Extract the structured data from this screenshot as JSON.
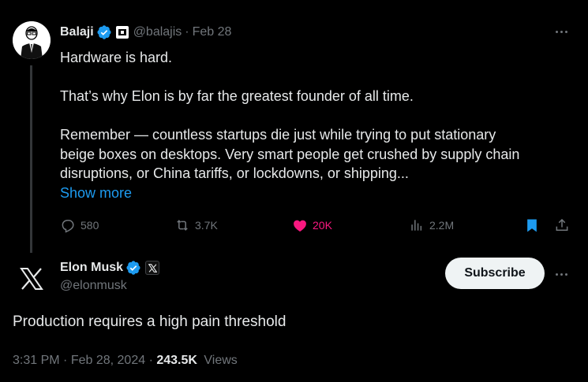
{
  "quoted_tweet": {
    "author_name": "Balaji",
    "handle": "@balajis",
    "separator": "·",
    "date": "Feb 28",
    "lines": [
      "Hardware is hard.",
      "That’s why Elon is by far the greatest founder of all time.",
      "Remember — countless startups die just while trying to put stationary",
      "beige boxes on desktops. Very smart people get crushed by supply chain",
      "disruptions, or China tariffs, or lockdowns, or shipping..."
    ],
    "show_more": "Show more",
    "stats": {
      "replies": "580",
      "reposts": "3.7K",
      "likes": "20K",
      "views": "2.2M"
    },
    "liked": true,
    "bookmarked": true
  },
  "main_tweet": {
    "author_name": "Elon Musk",
    "handle": "@elonmusk",
    "text": "Production requires a high pain threshold",
    "time": "3:31 PM",
    "date": "Feb 28, 2024",
    "views_count": "243.5K",
    "views_label": "Views"
  },
  "subscribe_label": "Subscribe",
  "colors": {
    "background": "#000000",
    "text": "#e7e9ea",
    "muted": "#71767b",
    "accent": "#1d9bf0",
    "like": "#f91880"
  },
  "icons": [
    "verified-badge-icon",
    "affiliate-badge-icon",
    "x-logo-icon",
    "reply-icon",
    "repost-icon",
    "heart-icon",
    "views-icon",
    "bookmark-icon",
    "share-icon",
    "more-icon"
  ]
}
